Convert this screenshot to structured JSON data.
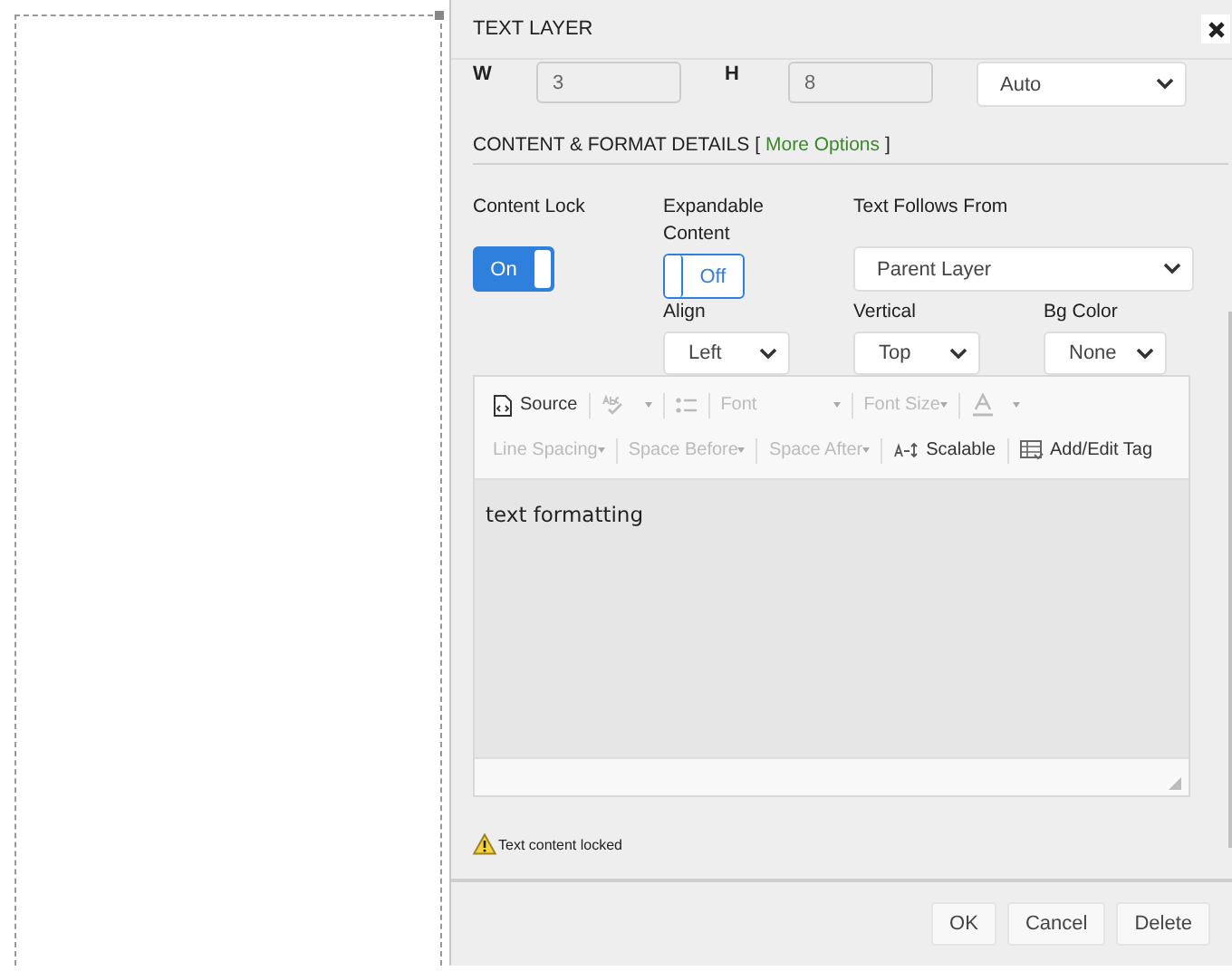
{
  "dialog": {
    "title": "TEXT LAYER"
  },
  "size": {
    "w_label": "W",
    "w_value": "3",
    "h_label": "H",
    "h_value": "8",
    "mode": "Auto"
  },
  "section": {
    "title": "CONTENT & FORMAT DETAILS [",
    "link": "More Options",
    "close": "]"
  },
  "content_lock": {
    "label": "Content Lock",
    "on": true,
    "text": "On"
  },
  "expandable": {
    "label": "Expandable Content",
    "on": false,
    "text": "Off"
  },
  "text_follows": {
    "label": "Text Follows From",
    "value": "Parent Layer"
  },
  "align": {
    "label": "Align",
    "value": "Left"
  },
  "vertical": {
    "label": "Vertical",
    "value": "Top"
  },
  "bg_color": {
    "label": "Bg Color",
    "value": "None"
  },
  "toolbar_rows": [
    [
      {
        "kind": "source",
        "label": "Source",
        "disabled": false
      },
      {
        "kind": "spellcheck",
        "disabled": true
      },
      {
        "kind": "list",
        "disabled": true
      },
      {
        "kind": "dropdown",
        "label": "Font",
        "disabled": true
      },
      {
        "kind": "dropdown",
        "label": "Font Size",
        "disabled": true
      },
      {
        "kind": "fontcolor",
        "disabled": true
      }
    ],
    [
      {
        "kind": "dropdown",
        "label": "Line Spacing",
        "disabled": true
      },
      {
        "kind": "dropdown",
        "label": "Space Before",
        "disabled": true
      },
      {
        "kind": "dropdown",
        "label": "Space After",
        "disabled": true
      },
      {
        "kind": "scalable",
        "label": "Scalable",
        "disabled": false
      },
      {
        "kind": "tag",
        "label": "Add/Edit Tag",
        "disabled": false
      }
    ]
  ],
  "editor": {
    "text": "text formatting"
  },
  "notice": "Text content locked",
  "buttons": [
    "OK",
    "Cancel",
    "Delete"
  ]
}
